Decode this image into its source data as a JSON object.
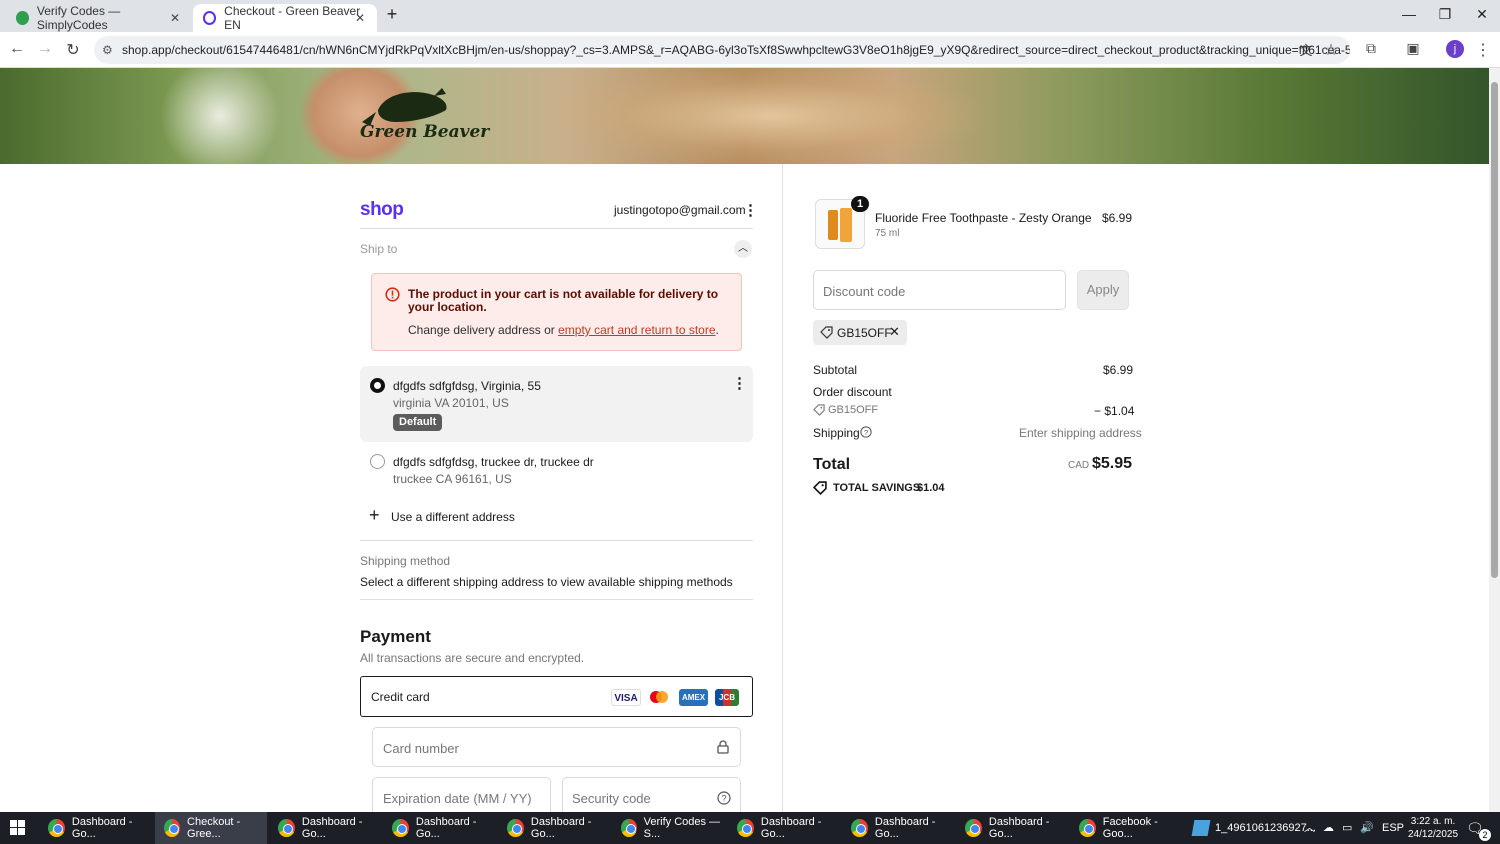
{
  "browser": {
    "tabs": [
      {
        "label": "Verify Codes — SimplyCodes",
        "active": false
      },
      {
        "label": "Checkout - Green Beaver EN",
        "active": true
      }
    ],
    "url": "shop.app/checkout/61547446481/cn/hWN6nCMYjdRkPqVxltXcBHjm/en-us/shoppay?_cs=3.AMPS&_r=AQABG-6yl3oTsXf8SwwhpcltewG3V8eO1h8jgE9_yX9Q&redirect_source=direct_checkout_product&tracking_unique=fff61cea-5de9-4c6f-9..."
  },
  "hero": {
    "logo_text": "Green Beaver"
  },
  "checkout": {
    "shop_logo": "shop",
    "email": "justingotopo@gmail.com",
    "ship_to_label": "Ship to",
    "alert": {
      "title": "The product in your cart is not available for delivery to your location.",
      "body_prefix": "Change delivery address or ",
      "link": "empty cart and return to store",
      "body_suffix": "."
    },
    "addresses": [
      {
        "name": "dfgdfs sdfgfdsg, Virginia, 55",
        "detail": "virginia VA 20101, US",
        "badge": "Default",
        "selected": true
      },
      {
        "name": "dfgdfs sdfgfdsg, truckee dr, truckee dr",
        "detail": "truckee CA 96161, US",
        "selected": false
      }
    ],
    "use_different_address": "Use a different address",
    "shipping_method_label": "Shipping method",
    "shipping_method_text": "Select a different shipping address to view available shipping methods",
    "payment": {
      "title": "Payment",
      "subtitle": "All transactions are secure and encrypted.",
      "method": "Credit card",
      "cards": [
        "VISA",
        "mastercard",
        "AMEX",
        "JCB"
      ],
      "card_number_placeholder": "Card number",
      "expiry_placeholder": "Expiration date (MM / YY)",
      "cvc_placeholder": "Security code"
    }
  },
  "summary": {
    "product": {
      "quantity": "1",
      "name": "Fluoride Free Toothpaste - Zesty Orange",
      "variant": "75 ml",
      "price": "$6.99"
    },
    "discount_placeholder": "Discount code",
    "apply_label": "Apply",
    "applied_code": "GB15OFF",
    "subtotal_label": "Subtotal",
    "subtotal_value": "$6.99",
    "order_discount_label": "Order discount",
    "order_discount_code": "GB15OFF",
    "order_discount_value": "− $1.04",
    "shipping_label": "Shipping",
    "shipping_value": "Enter shipping address",
    "total_label": "Total",
    "currency": "CAD",
    "total_value": "$5.95",
    "savings_label": "TOTAL SAVINGS",
    "savings_value": "$1.04"
  },
  "taskbar": {
    "items": [
      "Dashboard - Go...",
      "Checkout - Gree...",
      "Dashboard - Go...",
      "Dashboard - Go...",
      "Dashboard - Go...",
      "Verify Codes — S...",
      "Dashboard - Go...",
      "Dashboard - Go...",
      "Dashboard - Go...",
      "Facebook - Goo...",
      "1_4961061236927..."
    ],
    "language": "ESP",
    "time": "3:22 a. m.",
    "date": "24/12/2025",
    "notifications": "2"
  },
  "colors": {
    "shop_purple": "#5a31f4",
    "alert_red": "#d72c0d",
    "link_red": "#c0392b"
  }
}
